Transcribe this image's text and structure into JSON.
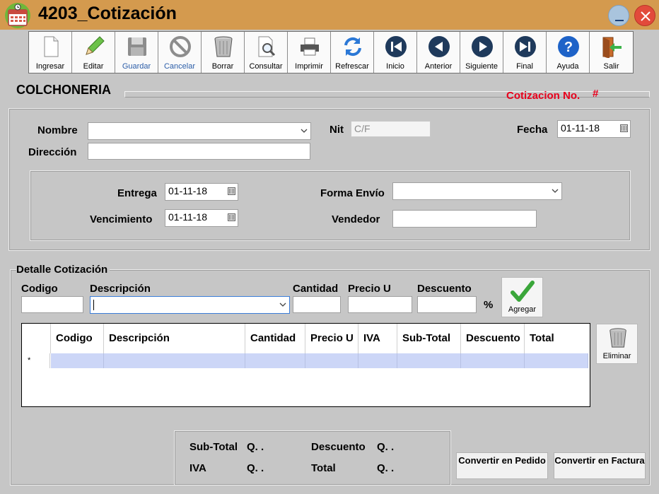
{
  "window": {
    "title": "4203_Cotización",
    "accent": "#d49a4e"
  },
  "toolbar": [
    {
      "label": "Ingresar",
      "icon": "new-document-icon"
    },
    {
      "label": "Editar",
      "icon": "pencil-icon"
    },
    {
      "label": "Guardar",
      "icon": "floppy-disk-icon"
    },
    {
      "label": "Cancelar",
      "icon": "cancel-icon"
    },
    {
      "label": "Borrar",
      "icon": "trash-icon"
    },
    {
      "label": "Consultar",
      "icon": "search-document-icon"
    },
    {
      "label": "Imprimir",
      "icon": "printer-icon"
    },
    {
      "label": "Refrescar",
      "icon": "refresh-icon"
    },
    {
      "label": "Inicio",
      "icon": "first-icon"
    },
    {
      "label": "Anterior",
      "icon": "previous-icon"
    },
    {
      "label": "Siguiente",
      "icon": "next-icon"
    },
    {
      "label": "Final",
      "icon": "last-icon"
    },
    {
      "label": "Ayuda",
      "icon": "help-icon"
    },
    {
      "label": "Salir",
      "icon": "exit-door-icon"
    }
  ],
  "header": {
    "section_title": "COLCHONERIA",
    "cotizacion_label": "Cotizacion No.",
    "cotizacion_number": "#"
  },
  "form": {
    "nombre_label": "Nombre",
    "nombre_value": "",
    "nit_label": "Nit",
    "nit_value": "C/F",
    "fecha_label": "Fecha",
    "fecha_value": "01-11-18",
    "direccion_label": "Dirección",
    "direccion_value": "",
    "entrega_label": "Entrega",
    "entrega_value": "01-11-18",
    "vencimiento_label": "Vencimiento",
    "vencimiento_value": "01-11-18",
    "forma_envio_label": "Forma Envío",
    "forma_envio_value": "",
    "vendedor_label": "Vendedor",
    "vendedor_value": ""
  },
  "detalle": {
    "title": "Detalle Cotización",
    "codigo_label": "Codigo",
    "descripcion_label": "Descripción",
    "cantidad_label": "Cantidad",
    "precio_label": "Precio U",
    "descuento_label": "Descuento",
    "percent": "%",
    "agregar_label": "Agregar",
    "eliminar_label": "Eliminar"
  },
  "grid": {
    "columns": [
      "Codigo",
      "Descripción",
      "Cantidad",
      "Precio U",
      "IVA",
      "Sub-Total",
      "Descuento",
      "Total"
    ],
    "new_row_marker": "*"
  },
  "totals": {
    "subtotal_label": "Sub-Total",
    "subtotal_value": "Q. .",
    "descuento_label": "Descuento",
    "descuento_value": "Q. .",
    "iva_label": "IVA",
    "iva_value": "Q. .",
    "total_label": "Total",
    "total_value": "Q. ."
  },
  "actions": {
    "pedido_label": "Convertir en Pedido",
    "factura_label": "Convertir en Factura"
  }
}
